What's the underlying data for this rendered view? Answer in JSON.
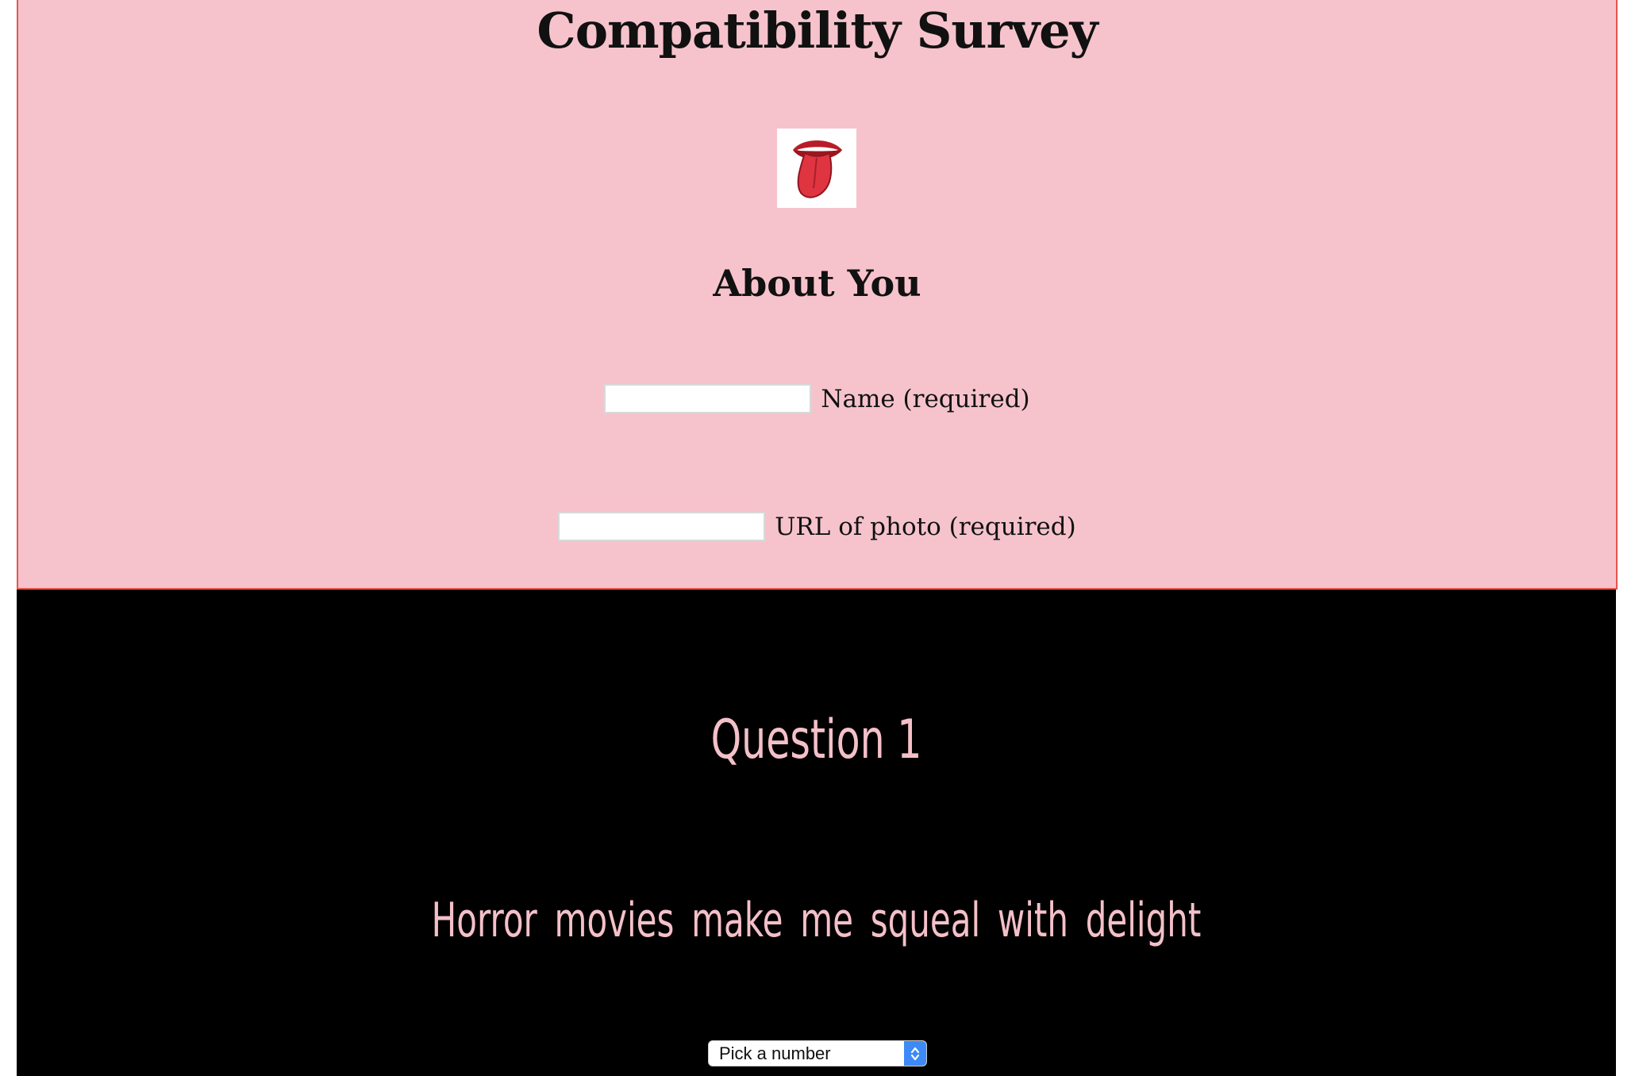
{
  "header": {
    "title": "Compatibility Survey"
  },
  "logo": {
    "icon": "tongue-lips-icon",
    "colors": {
      "lips": "#c81e2a",
      "tongue": "#e23a43",
      "teeth": "#ffffff"
    }
  },
  "about": {
    "section_title": "About You",
    "name_field": {
      "label": "Name (required)",
      "value": ""
    },
    "photo_field": {
      "label": "URL of photo (required)",
      "value": ""
    }
  },
  "question": {
    "title": "Question 1",
    "text": "Horror movies make me squeal with delight",
    "select": {
      "selected": "Pick a number"
    }
  },
  "colors": {
    "about_background": "#f6c3cc",
    "about_border": "#e5554f",
    "question_background": "#000000",
    "question_text": "#f4c0c8",
    "select_accent": "#3d8af7"
  }
}
